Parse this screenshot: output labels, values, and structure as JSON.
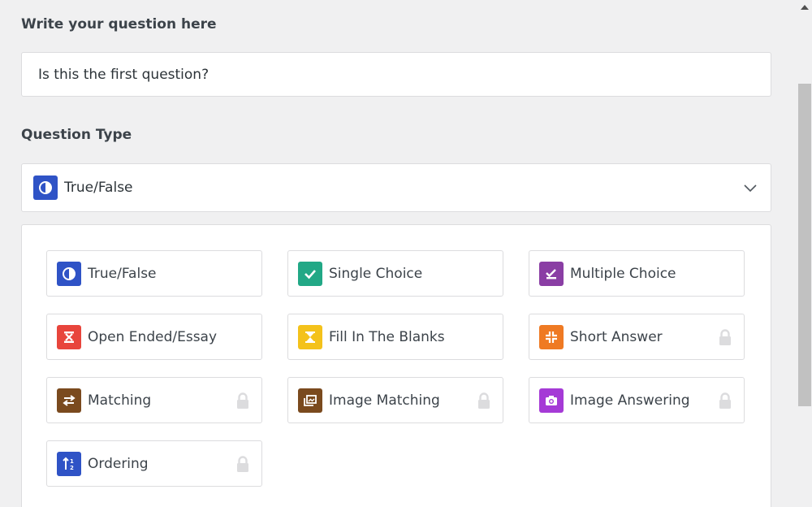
{
  "question": {
    "label": "Write your question here",
    "value": "Is this the first question?"
  },
  "question_type": {
    "label": "Question Type",
    "selected": "True/False",
    "selected_icon": "true-false-icon"
  },
  "options": [
    {
      "label": "True/False",
      "icon": "true-false-icon",
      "color": "#2f53c6",
      "locked": false
    },
    {
      "label": "Single Choice",
      "icon": "checkmark-icon",
      "color": "#22a886",
      "locked": false
    },
    {
      "label": "Multiple Choice",
      "icon": "double-check-icon",
      "color": "#8a3ea4",
      "locked": false
    },
    {
      "label": "Open Ended/Essay",
      "icon": "essay-icon",
      "color": "#e8453c",
      "locked": false
    },
    {
      "label": "Fill In The Blanks",
      "icon": "hourglass-icon",
      "color": "#f4c21b",
      "locked": false
    },
    {
      "label": "Short Answer",
      "icon": "compress-icon",
      "color": "#ef7a23",
      "locked": true
    },
    {
      "label": "Matching",
      "icon": "swap-arrows-icon",
      "color": "#7a4a1e",
      "locked": true
    },
    {
      "label": "Image Matching",
      "icon": "image-gallery-icon",
      "color": "#7a4a1e",
      "locked": true
    },
    {
      "label": "Image Answering",
      "icon": "camera-icon",
      "color": "#a53ad6",
      "locked": true
    },
    {
      "label": "Ordering",
      "icon": "sort-icon",
      "color": "#2f53c6",
      "locked": true
    }
  ]
}
